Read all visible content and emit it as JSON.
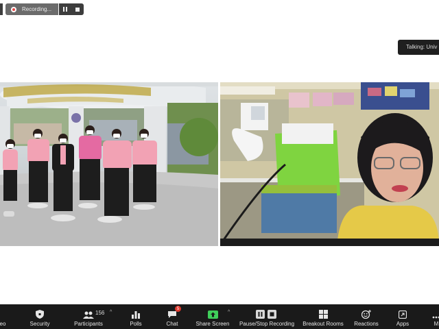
{
  "recording": {
    "label": "Recording..."
  },
  "talking": {
    "label": "Talking: Univ"
  },
  "toolbar": {
    "video_label": "eo",
    "security_label": "Security",
    "participants_label": "Participants",
    "participants_count": "156",
    "polls_label": "Polls",
    "chat_label": "Chat",
    "chat_badge": "5",
    "share_label": "Share Screen",
    "recording_label": "Pause/Stop Recording",
    "breakout_label": "Breakout Rooms",
    "reactions_label": "Reactions",
    "apps_label": "Apps",
    "more_label": "M"
  },
  "colors": {
    "toolbar_bg": "#1a1a1a",
    "share_green": "#3fcf5a",
    "badge_red": "#e03a2f",
    "record_red": "#e54848"
  }
}
